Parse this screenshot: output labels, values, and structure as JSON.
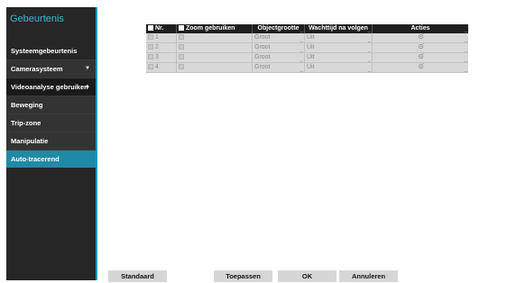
{
  "sidebar": {
    "title": "Gebeurtenis",
    "items": [
      {
        "label": "Systeemgebeurtenis"
      },
      {
        "label": "Camerasysteem",
        "arrow": "▼"
      },
      {
        "label": "Videoanalyse gebruiken",
        "arrow": "▲"
      },
      {
        "label": "Beweging"
      },
      {
        "label": "Trip-zone"
      },
      {
        "label": "Manipulatie"
      },
      {
        "label": "Auto-tracerend"
      }
    ],
    "active_color": "#1f8aa6",
    "accent_color": "#1f9bb8"
  },
  "table": {
    "headers": {
      "nr": "Nr.",
      "zoom": "Zoom gebruiken",
      "object_size": "Objectgrootte",
      "wait_time": "Wachttijd na volgen",
      "actions": "Acties"
    },
    "rows": [
      {
        "nr": "1",
        "object_size": "Groot",
        "wait_time": "Uit",
        "action_icon": "settings-icon"
      },
      {
        "nr": "2",
        "object_size": "Groot",
        "wait_time": "Uit",
        "action_icon": "settings-icon"
      },
      {
        "nr": "3",
        "object_size": "Groot",
        "wait_time": "Uit",
        "action_icon": "settings-icon"
      },
      {
        "nr": "4",
        "object_size": "Groot",
        "wait_time": "Uit",
        "action_icon": "settings-icon"
      }
    ]
  },
  "buttons": {
    "default": "Standaard",
    "apply": "Toepassen",
    "ok": "OK",
    "cancel": "Annuleren"
  }
}
